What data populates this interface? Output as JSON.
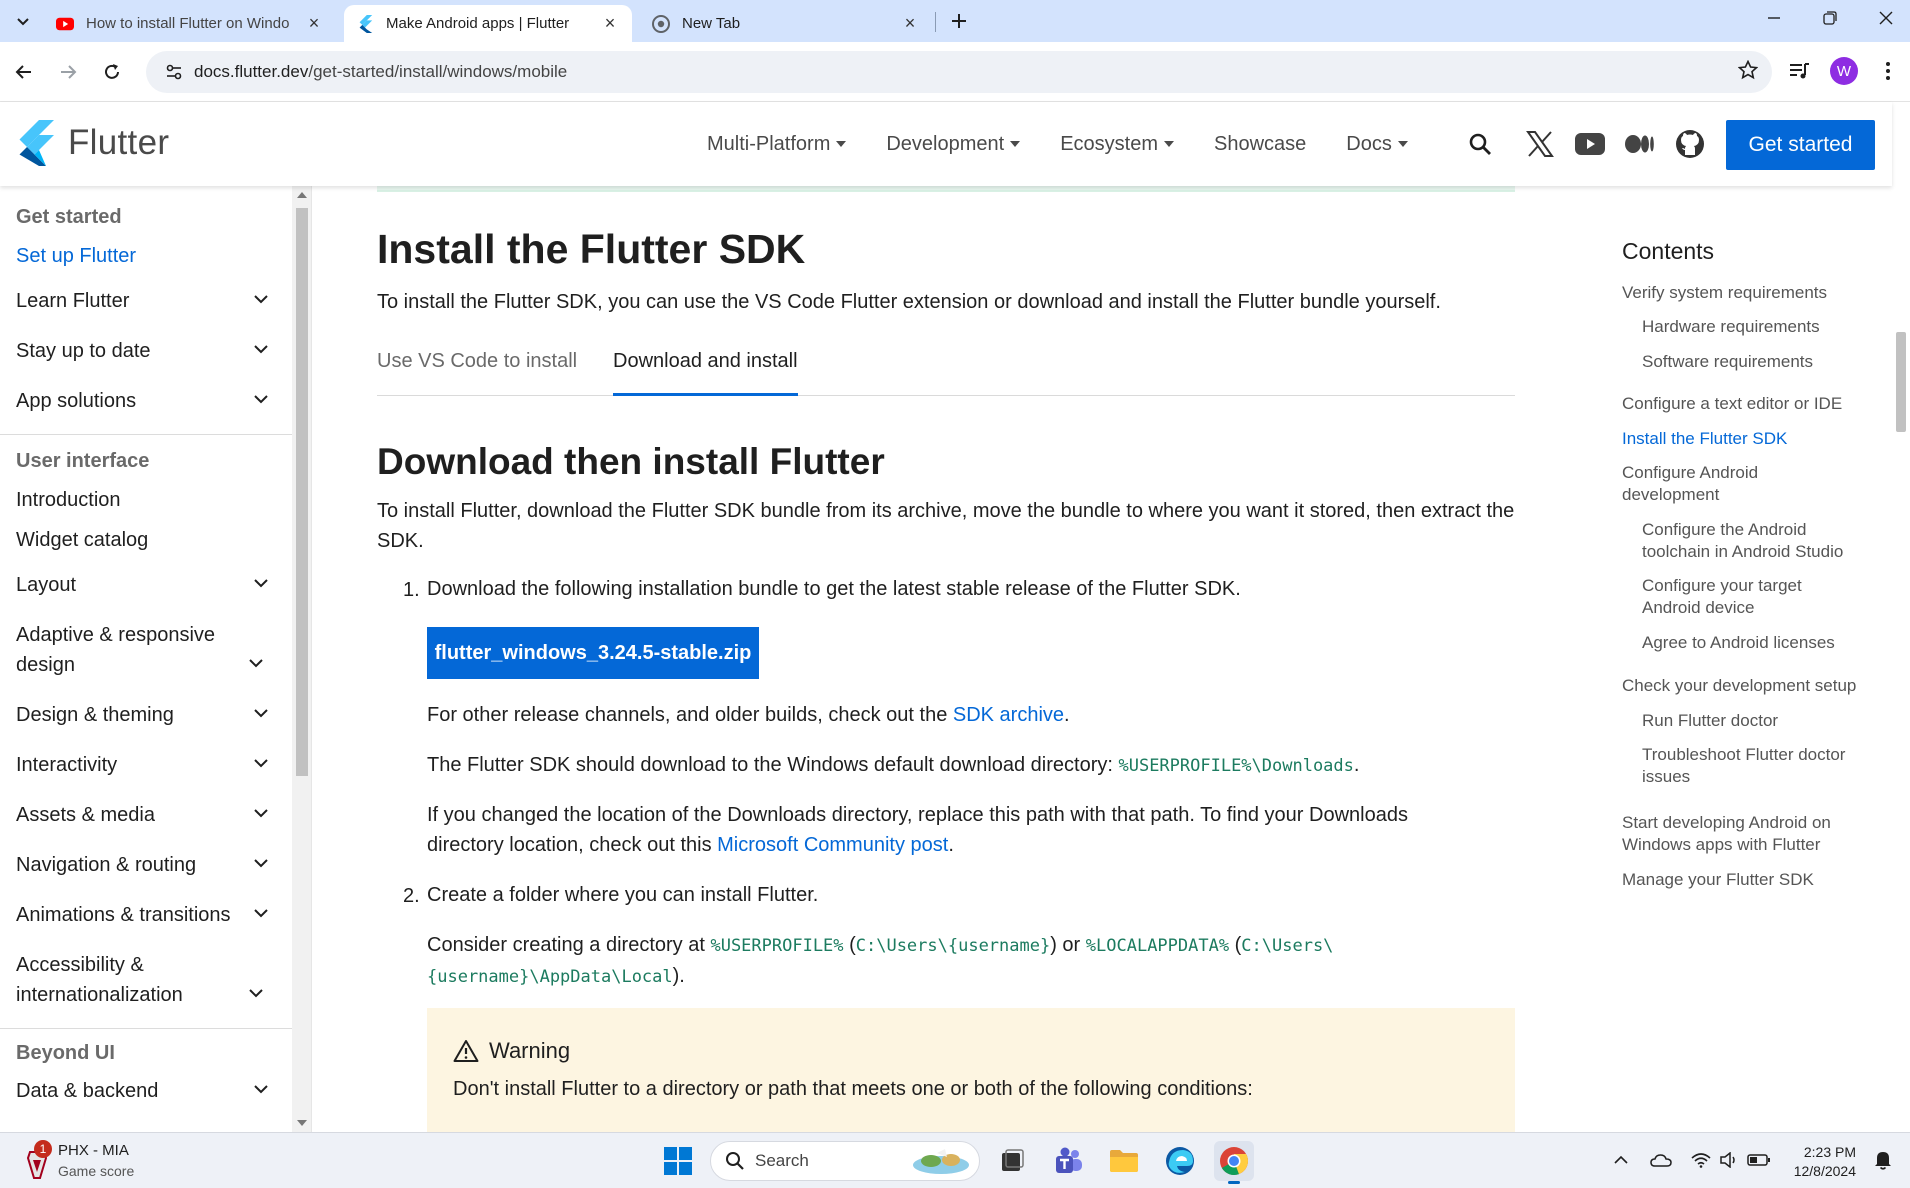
{
  "browser": {
    "tabs": [
      {
        "title": "How to install Flutter on Windo",
        "favicon": "youtube-icon"
      },
      {
        "title": "Make Android apps | Flutter",
        "favicon": "flutter-icon"
      },
      {
        "title": "New Tab",
        "favicon": "chrome-icon"
      }
    ],
    "url_host": "docs.flutter.dev",
    "url_path": "/get-started/install/windows/mobile",
    "profile_initial": "W"
  },
  "site": {
    "logo_text": "Flutter",
    "nav": [
      "Multi-Platform",
      "Development",
      "Ecosystem",
      "Showcase",
      "Docs"
    ],
    "cta": "Get started"
  },
  "sidebar": {
    "sections": [
      {
        "title": "Get started",
        "items": [
          {
            "label": "Set up Flutter",
            "active": true
          },
          {
            "label": "Learn Flutter",
            "expandable": true
          },
          {
            "label": "Stay up to date",
            "expandable": true
          },
          {
            "label": "App solutions",
            "expandable": true
          }
        ]
      },
      {
        "title": "User interface",
        "items": [
          {
            "label": "Introduction"
          },
          {
            "label": "Widget catalog"
          },
          {
            "label": "Layout",
            "expandable": true
          },
          {
            "label": "Adaptive & responsive design",
            "expandable": true
          },
          {
            "label": "Design & theming",
            "expandable": true
          },
          {
            "label": "Interactivity",
            "expandable": true
          },
          {
            "label": "Assets & media",
            "expandable": true
          },
          {
            "label": "Navigation & routing",
            "expandable": true
          },
          {
            "label": "Animations & transitions",
            "expandable": true
          },
          {
            "label": "Accessibility & internationalization",
            "expandable": true
          }
        ]
      },
      {
        "title": "Beyond UI",
        "items": [
          {
            "label": "Data & backend",
            "expandable": true
          }
        ]
      }
    ]
  },
  "content": {
    "h1": "Install the Flutter SDK",
    "intro": "To install the Flutter SDK, you can use the VS Code Flutter extension or download and install the Flutter bundle yourself.",
    "tabs": [
      "Use VS Code to install",
      "Download and install"
    ],
    "h2": "Download then install Flutter",
    "p1": "To install Flutter, download the Flutter SDK bundle from its archive, move the bundle to where you want it stored, then extract the SDK.",
    "step1_num": "1.",
    "step1": "Download the following installation bundle to get the latest stable release of the Flutter SDK.",
    "download_button": "flutter_windows_3.24.5-stable.zip",
    "other_pre": "For other release channels, and older builds, check out the ",
    "other_link": "SDK archive",
    "other_post": ".",
    "dir_pre": "The Flutter SDK should download to the Windows default download directory: ",
    "dir_code": "%USERPROFILE%\\Downloads",
    "dir_post": ".",
    "changed_pre": "If you changed the location of the Downloads directory, replace this path with that path. To find your Downloads directory location, check out this ",
    "changed_link": "Microsoft Community post",
    "changed_post": ".",
    "step2_num": "2.",
    "step2": "Create a folder where you can install Flutter.",
    "consider_pre": "Consider creating a directory at ",
    "consider_code1": "%USERPROFILE%",
    "consider_mid1": " (",
    "consider_code2": "C:\\Users\\{username}",
    "consider_mid2": ") or ",
    "consider_code3": "%LOCALAPPDATA%",
    "consider_mid3": " (",
    "consider_code4a": "C:\\Users\\",
    "consider_code4b": "{username}\\AppData\\Local",
    "consider_post": ").",
    "warning_title": "Warning",
    "warning_text": "Don't install Flutter to a directory or path that meets one or both of the following conditions:"
  },
  "toc": {
    "title": "Contents",
    "items": [
      {
        "label": "Verify system requirements",
        "level": 1
      },
      {
        "label": "Hardware requirements",
        "level": 2
      },
      {
        "label": "Software requirements",
        "level": 2
      },
      {
        "label": "Configure a text editor or IDE",
        "level": 1
      },
      {
        "label": "Install the Flutter SDK",
        "level": 1,
        "active": true
      },
      {
        "label": "Configure Android development",
        "level": 1
      },
      {
        "label": "Configure the Android toolchain in Android Studio",
        "level": 2
      },
      {
        "label": "Configure your target Android device",
        "level": 2
      },
      {
        "label": "Agree to Android licenses",
        "level": 2
      },
      {
        "label": "Check your development setup",
        "level": 1
      },
      {
        "label": "Run Flutter doctor",
        "level": 2
      },
      {
        "label": "Troubleshoot Flutter doctor issues",
        "level": 2
      },
      {
        "label": "Start developing Android on Windows apps with Flutter",
        "level": 1
      },
      {
        "label": "Manage your Flutter SDK",
        "level": 1
      }
    ]
  },
  "taskbar": {
    "widget_line1": "PHX - MIA",
    "widget_line2": "Game score",
    "widget_badge": "1",
    "search_placeholder": "Search",
    "time": "2:23 PM",
    "date": "12/8/2024"
  },
  "colors": {
    "accent": "#0468d7",
    "code": "#1c7b5f",
    "warning_bg": "#fdf5e1"
  }
}
